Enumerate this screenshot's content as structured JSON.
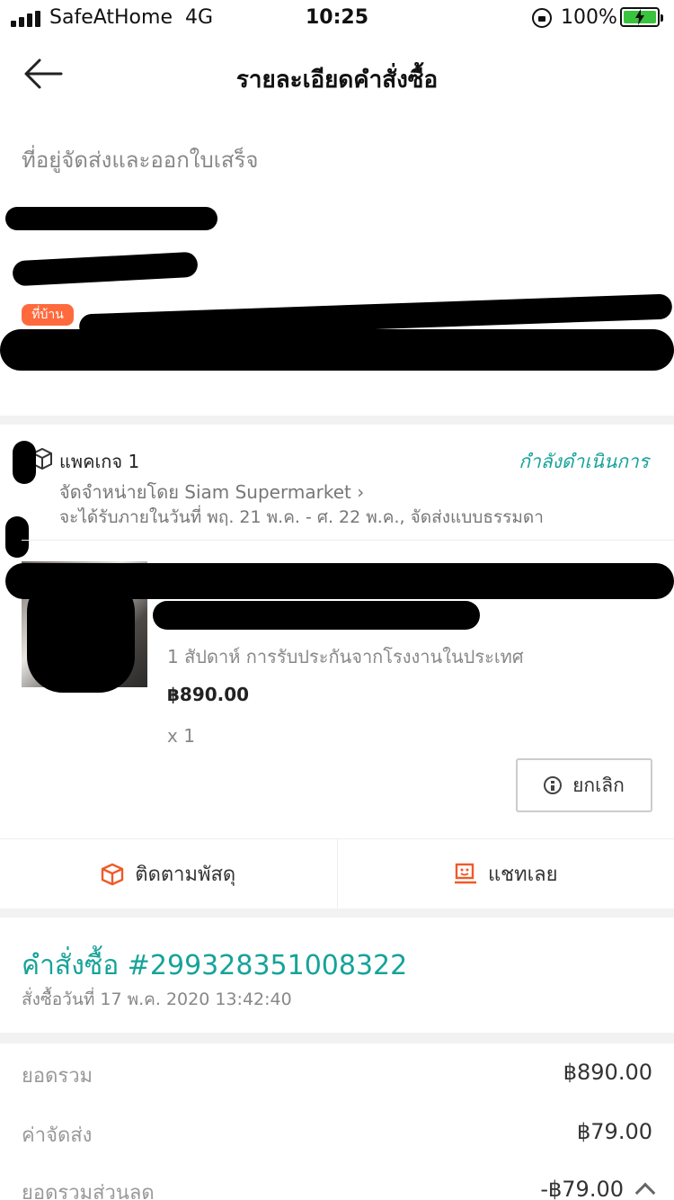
{
  "status_bar": {
    "carrier": "SafeAtHome  4G",
    "time": "10:25",
    "battery": "100%"
  },
  "header": {
    "title": "รายละเอียดคำสั่งซื้อ"
  },
  "address": {
    "section_label": "ที่อยู่จัดส่งและออกใบเสร็จ",
    "badge": "ที่บ้าน"
  },
  "package": {
    "title": "แพคเกจ 1",
    "status": "กำลังดำเนินการ",
    "seller": "จัดจำหน่ายโดย Siam Supermarket",
    "delivery": "จะได้รับภายในวันที่ พฤ. 21 พ.ค. - ศ. 22 พ.ค., จัดส่งแบบธรรมดา",
    "item": {
      "warranty": "1 สัปดาห์ การรับประกันจากโรงงานในประเทศ",
      "price": "฿890.00",
      "qty": "x 1"
    },
    "cancel_label": "ยกเลิก"
  },
  "actions": {
    "track": "ติดตามพัสดุ",
    "chat": "แชทเลย"
  },
  "order": {
    "number": "คำสั่งซื้อ #299328351008322",
    "date": "สั่งซื้อวันที่ 17 พ.ค. 2020  13:42:40"
  },
  "summary": {
    "rows": [
      {
        "label": "ยอดรวม",
        "value": "฿890.00"
      },
      {
        "label": "ค่าจัดส่ง",
        "value": "฿79.00"
      },
      {
        "label": "ยอดรวมส่วนลด",
        "value": "-฿79.00"
      }
    ]
  },
  "colors": {
    "accent": "#16a39a",
    "orange": "#ff6a3d",
    "battery": "#3ac33d"
  }
}
